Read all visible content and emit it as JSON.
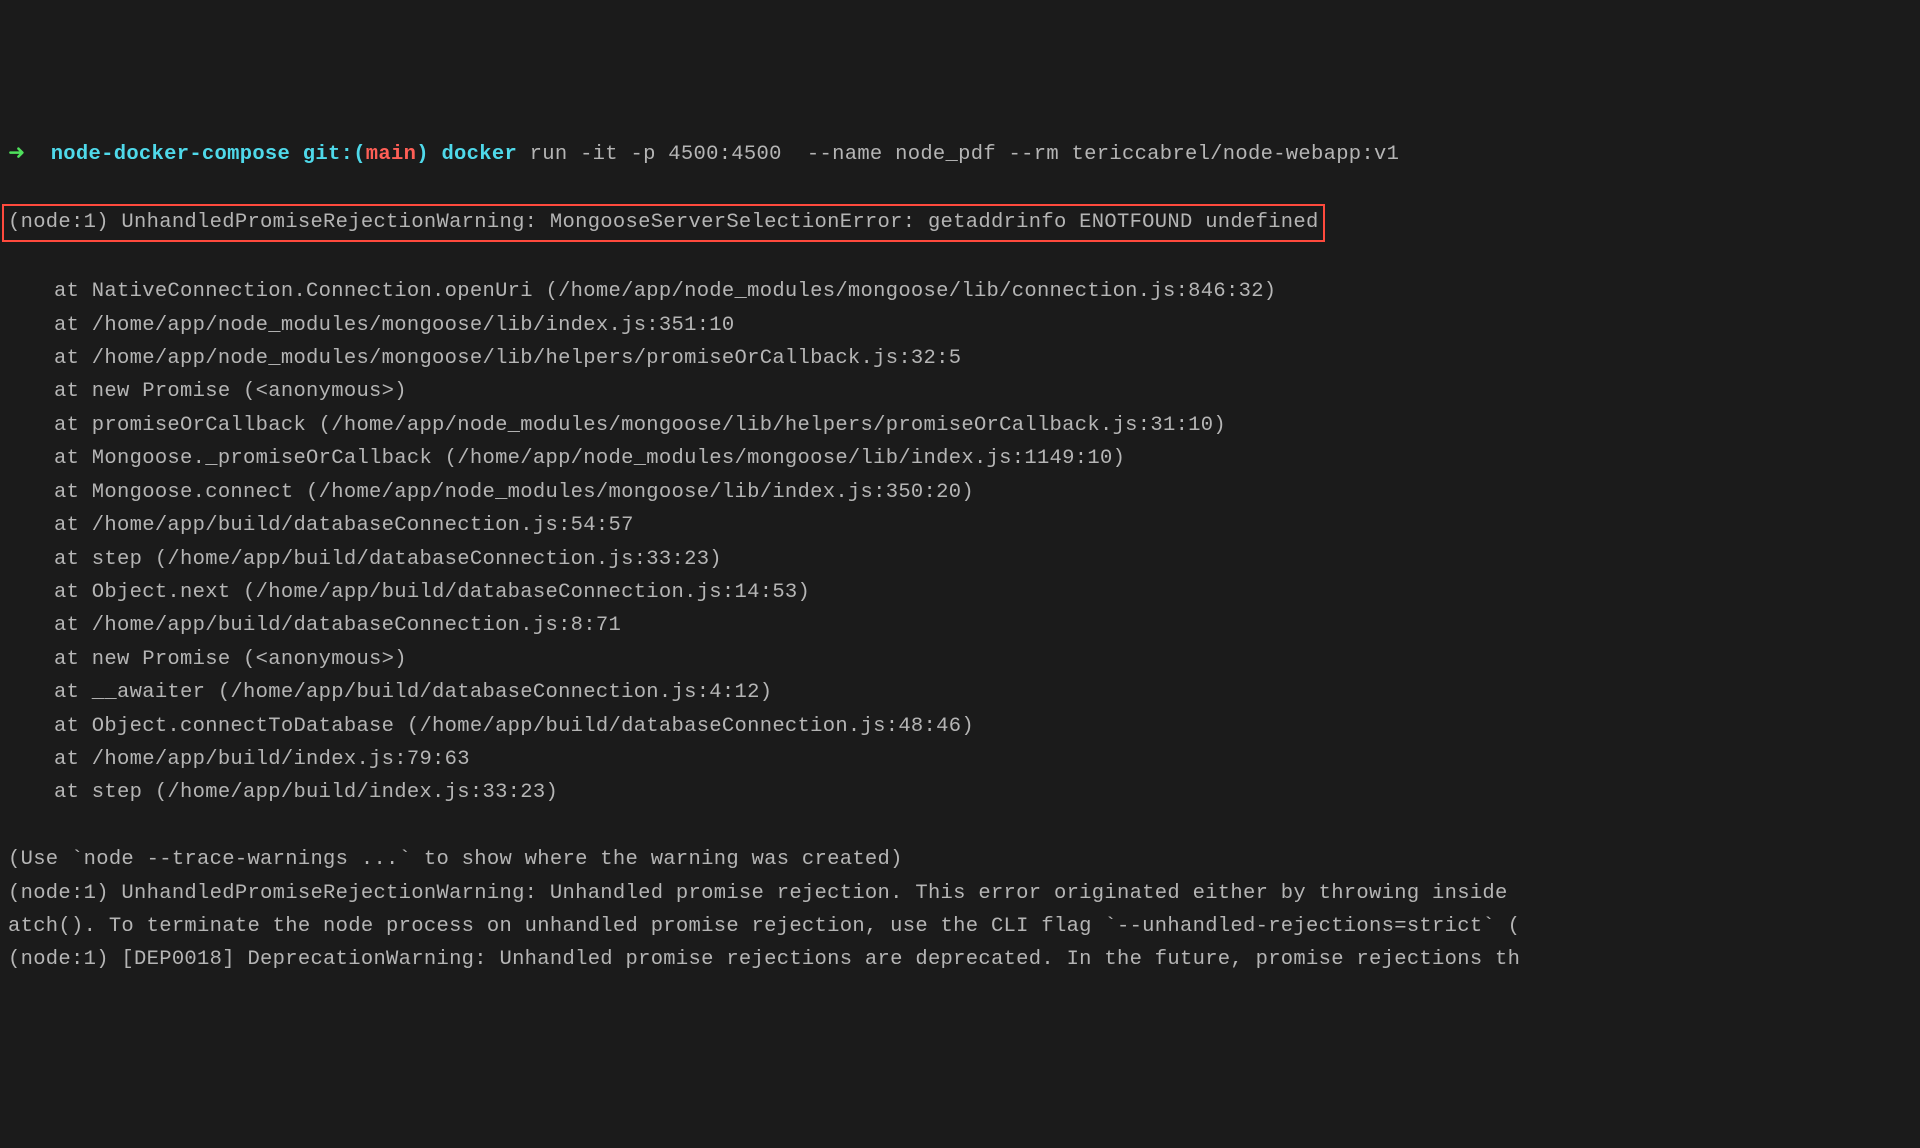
{
  "prompt": {
    "arrow": "➜",
    "path": "node-docker-compose",
    "git_label": "git:",
    "paren_open": "(",
    "branch": "main",
    "paren_close": ")",
    "command": "docker",
    "args": "run -it -p 4500:4500  --name node_pdf --rm tericcabrel/node-webapp:v1"
  },
  "error_highlight": "(node:1) UnhandledPromiseRejectionWarning: MongooseServerSelectionError: getaddrinfo ENOTFOUND undefined",
  "stack": [
    "at NativeConnection.Connection.openUri (/home/app/node_modules/mongoose/lib/connection.js:846:32)",
    "at /home/app/node_modules/mongoose/lib/index.js:351:10",
    "at /home/app/node_modules/mongoose/lib/helpers/promiseOrCallback.js:32:5",
    "at new Promise (<anonymous>)",
    "at promiseOrCallback (/home/app/node_modules/mongoose/lib/helpers/promiseOrCallback.js:31:10)",
    "at Mongoose._promiseOrCallback (/home/app/node_modules/mongoose/lib/index.js:1149:10)",
    "at Mongoose.connect (/home/app/node_modules/mongoose/lib/index.js:350:20)",
    "at /home/app/build/databaseConnection.js:54:57",
    "at step (/home/app/build/databaseConnection.js:33:23)",
    "at Object.next (/home/app/build/databaseConnection.js:14:53)",
    "at /home/app/build/databaseConnection.js:8:71",
    "at new Promise (<anonymous>)",
    "at __awaiter (/home/app/build/databaseConnection.js:4:12)",
    "at Object.connectToDatabase (/home/app/build/databaseConnection.js:48:46)",
    "at /home/app/build/index.js:79:63",
    "at step (/home/app/build/index.js:33:23)"
  ],
  "footer": [
    "(Use `node --trace-warnings ...` to show where the warning was created)",
    "(node:1) UnhandledPromiseRejectionWarning: Unhandled promise rejection. This error originated either by throwing inside ",
    "atch(). To terminate the node process on unhandled promise rejection, use the CLI flag `--unhandled-rejections=strict` (",
    "(node:1) [DEP0018] DeprecationWarning: Unhandled promise rejections are deprecated. In the future, promise rejections th"
  ]
}
